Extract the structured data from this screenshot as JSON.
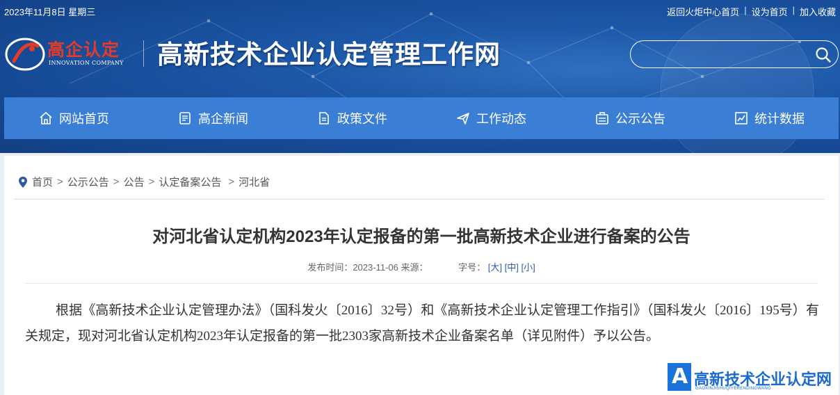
{
  "topbar": {
    "date": "2023年11月8日 星期三",
    "links": [
      "返回火炬中心首页",
      "设为首页",
      "加入收藏"
    ]
  },
  "logo": {
    "text": "高企认定",
    "sub": "INNOVATION COMPANY"
  },
  "site_title": "高新技术企业认定管理工作网",
  "search": {
    "value": "",
    "icon": "search-icon"
  },
  "nav": [
    {
      "label": "网站首页",
      "icon": "home-icon"
    },
    {
      "label": "高企新闻",
      "icon": "news-icon"
    },
    {
      "label": "政策文件",
      "icon": "document-icon"
    },
    {
      "label": "工作动态",
      "icon": "send-icon"
    },
    {
      "label": "公示公告",
      "icon": "notice-icon"
    },
    {
      "label": "统计数据",
      "icon": "chart-icon"
    }
  ],
  "breadcrumb": [
    "首页",
    "公示公告",
    "公告",
    "认定备案公告",
    "河北省"
  ],
  "article": {
    "title": "对河北省认定机构2023年认定报备的第一批高新技术企业进行备案的公告",
    "meta_publish": "发布时间：2023-11-06 来源：",
    "meta_font": "字号：",
    "sizes": [
      "[大]",
      "[中]",
      "[小]"
    ],
    "body": "根据《高新技术企业认定管理办法》（国科发火〔2016〕32号）和《高新技术企业认定管理工作指引》（国科发火〔2016〕195号）有关规定，现对河北省认定机构2023年认定报备的第一批2303家高新技术企业备案名单（详见附件）予以公告。"
  },
  "watermark": {
    "letter": "A",
    "text": "高新技术企业认定网",
    "sub": "GAOXINJISHUQIYERENDINGWANG"
  },
  "colors": {
    "nav": "#3a7fd5",
    "header": "#1d58a8",
    "logo_red": "#e23b2a"
  }
}
